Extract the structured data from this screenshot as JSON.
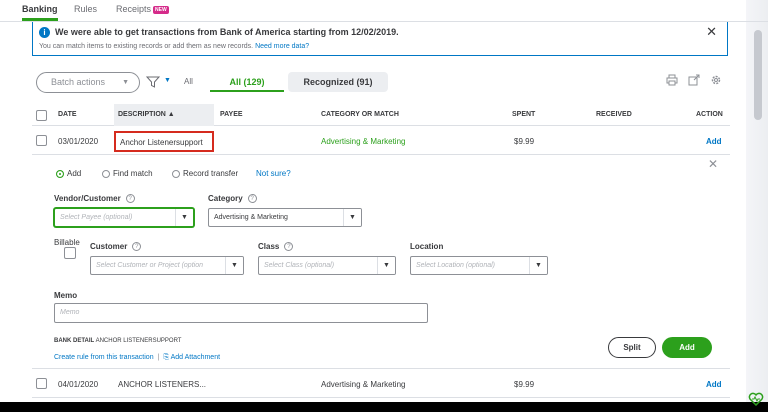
{
  "tabs": [
    {
      "label": "Banking",
      "active": true
    },
    {
      "label": "Rules",
      "active": false
    },
    {
      "label": "Receipts",
      "active": false,
      "badge": "NEW"
    }
  ],
  "banner": {
    "title": "We were able to get transactions from Bank of America starting from 12/02/2019.",
    "subtitle": "You can match items to existing records or add them as new records.",
    "link": "Need more data?",
    "close_icon": "close-icon"
  },
  "toolbar": {
    "batch_actions": "Batch actions",
    "filter_label": "All",
    "tab_all": "All (129)",
    "tab_recognized": "Recognized (91)"
  },
  "table": {
    "headers": {
      "date": "DATE",
      "description": "DESCRIPTION ▲",
      "payee": "PAYEE",
      "category": "CATEGORY OR MATCH",
      "spent": "SPENT",
      "received": "RECEIVED",
      "action": "ACTION"
    },
    "rows": [
      {
        "date": "03/01/2020",
        "description": "Anchor Listenersupport",
        "payee": "",
        "category": "Advertising & Marketing",
        "spent": "$9.99",
        "received": "",
        "action": "Add"
      },
      {
        "date": "04/01/2020",
        "description": "ANCHOR LISTENERS...",
        "payee": "",
        "category": "Advertising & Marketing",
        "spent": "$9.99",
        "received": "",
        "action": "Add"
      }
    ]
  },
  "detail": {
    "radios": {
      "add": "Add",
      "find_match": "Find match",
      "record_transfer": "Record transfer",
      "not_sure": "Not sure?"
    },
    "vendor_label": "Vendor/Customer",
    "vendor_placeholder": "Select Payee (optional)",
    "category_label": "Category",
    "category_value": "Advertising & Marketing",
    "billable_label": "Billable",
    "customer_label": "Customer",
    "customer_placeholder": "Select Customer or Project (option",
    "class_label": "Class",
    "class_placeholder": "Select Class (optional)",
    "location_label": "Location",
    "location_placeholder": "Select Location (optional)",
    "memo_label": "Memo",
    "memo_placeholder": "Memo",
    "bank_detail_label": "BANK DETAIL",
    "bank_detail_value": "ANCHOR LISTENERSUPPORT",
    "create_rule": "Create rule from this transaction",
    "add_attachment": "Add Attachment",
    "split_button": "Split",
    "add_button": "Add"
  },
  "colors": {
    "accent_green": "#2ca01c",
    "link_blue": "#0077c5",
    "highlight_red": "#d52b1e"
  }
}
